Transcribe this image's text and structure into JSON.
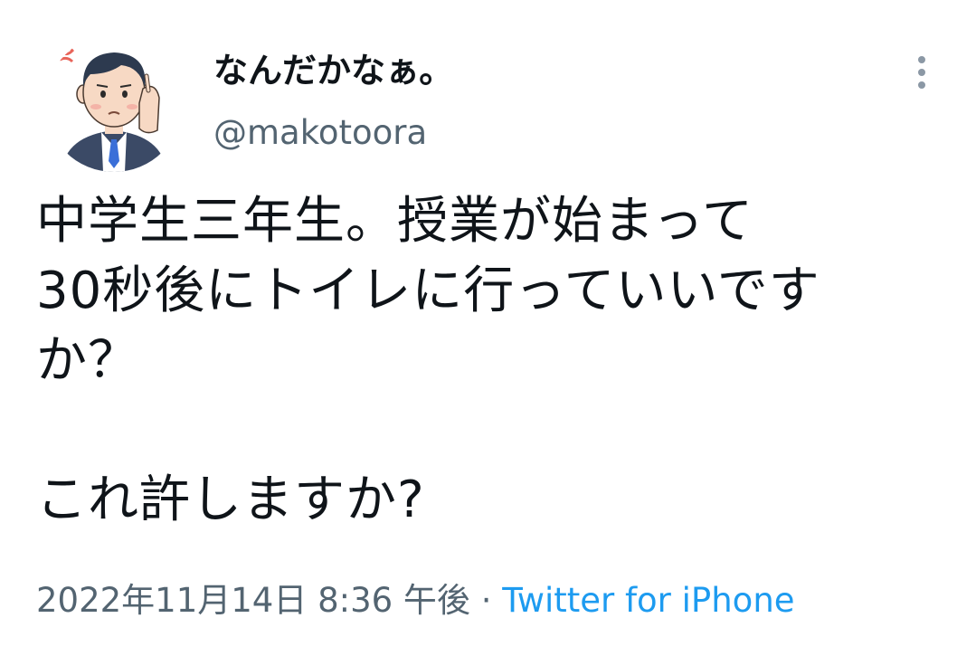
{
  "tweet": {
    "author": {
      "display_name": "なんだかなぁ。",
      "handle": "@makotoora",
      "avatar_icon": "user-avatar-businessman-icon"
    },
    "more_icon": "more-options-icon",
    "text": "中学生三年生。授業が始まって\n30秒後にトイレに行っていいです\nか？\n\nこれ許しますか?",
    "timestamp": "2022年11月14日 8:36 午後",
    "separator": "·",
    "source": "Twitter for iPhone"
  },
  "colors": {
    "text": "#0f1419",
    "secondary": "#536471",
    "link": "#1d9bf0"
  }
}
